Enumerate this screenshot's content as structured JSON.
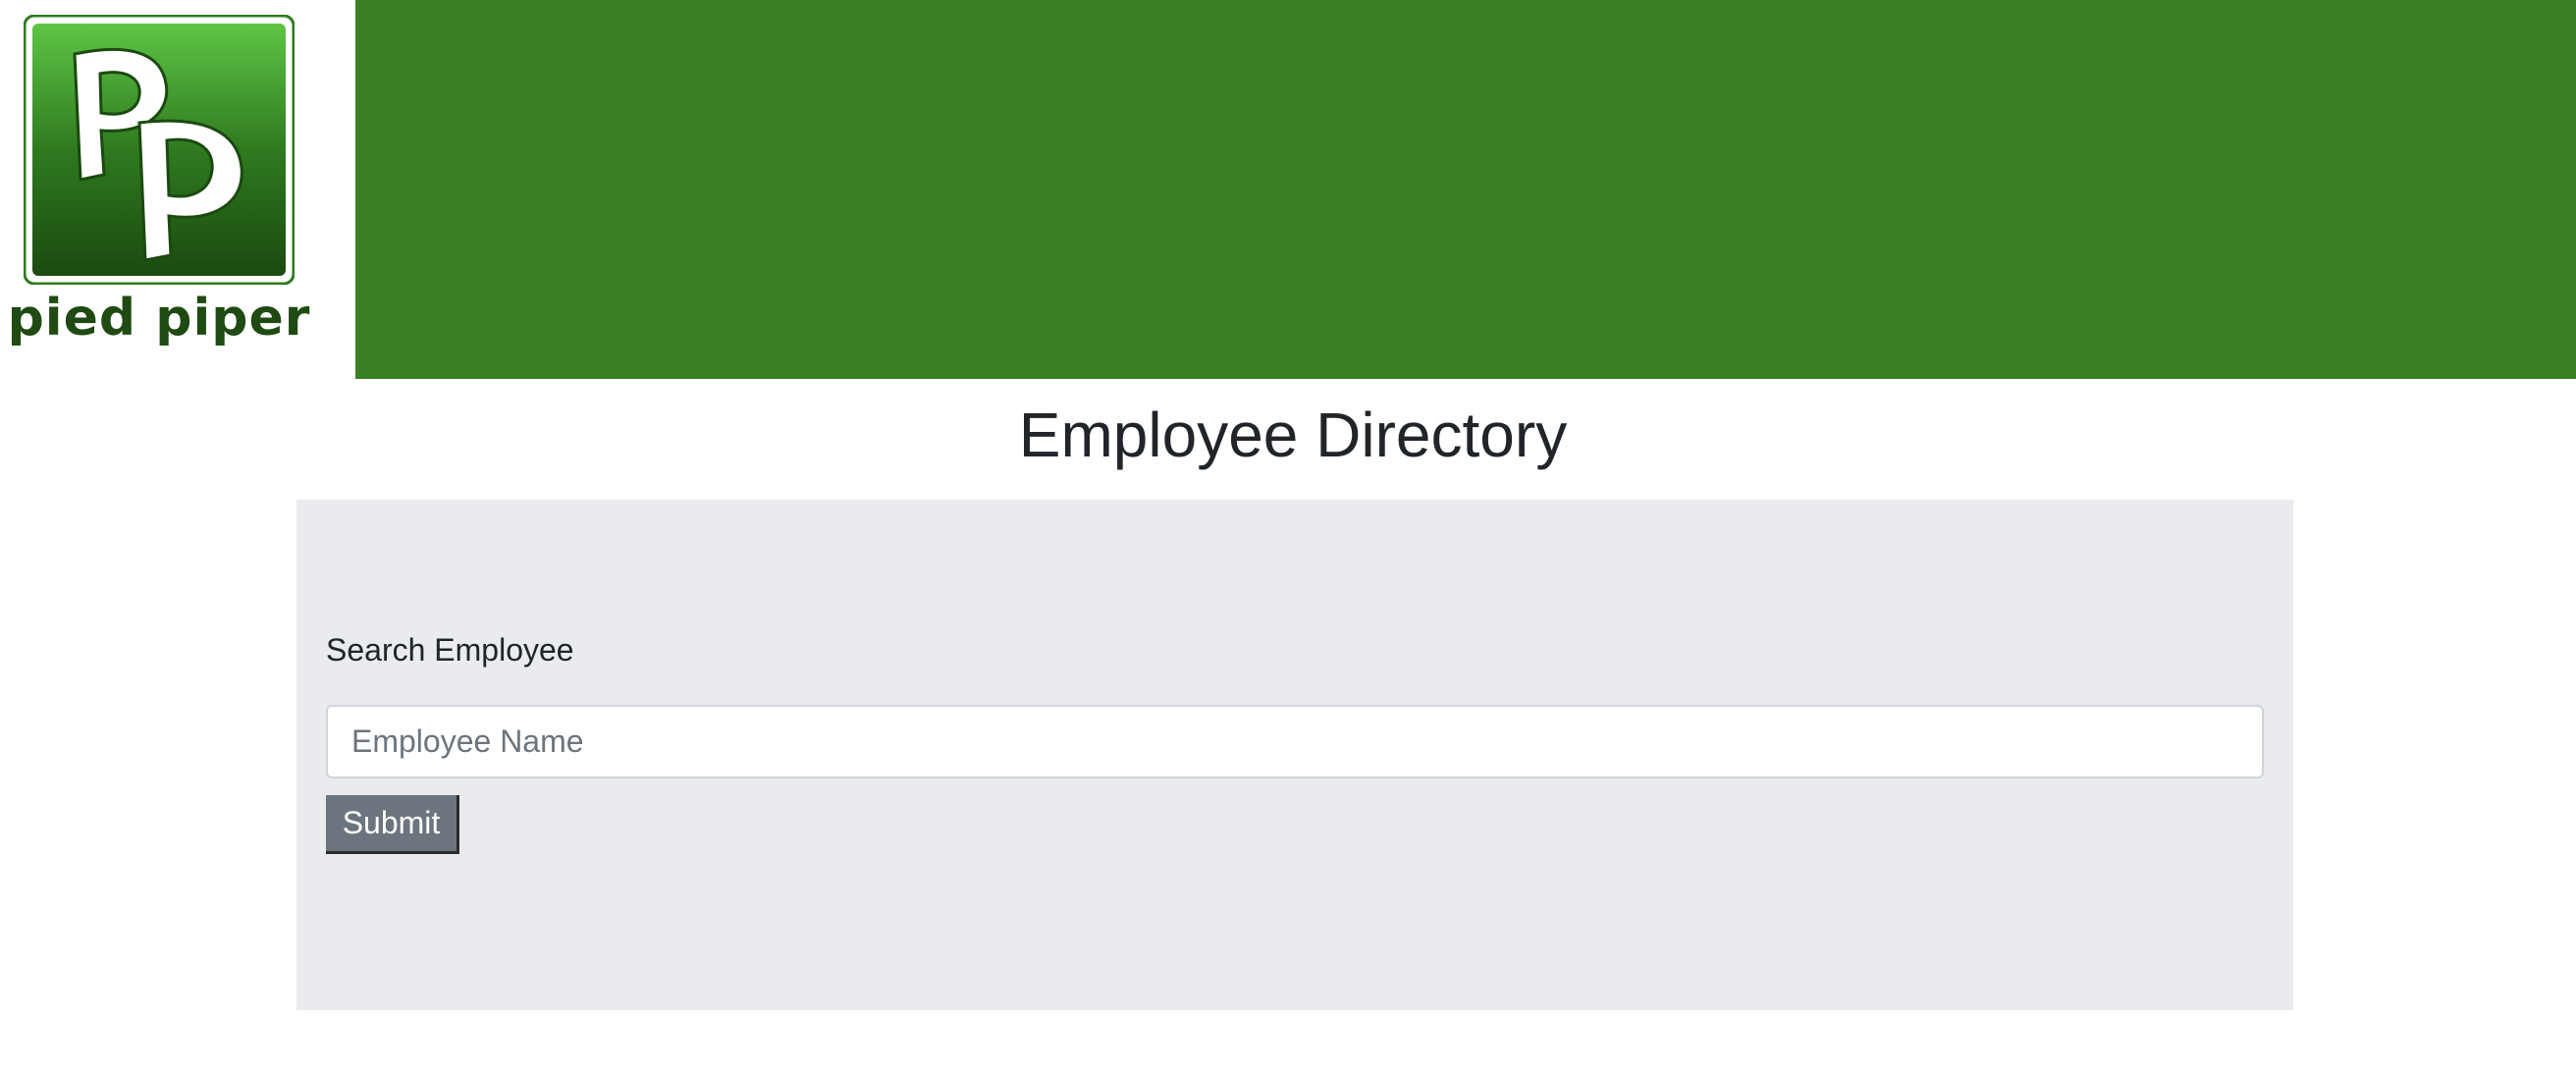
{
  "header": {
    "logo": {
      "monogram": "Pp",
      "wordmark": "pied piper"
    },
    "banner_color": "#388023"
  },
  "main": {
    "title": "Employee Directory",
    "search": {
      "label": "Search Employee",
      "placeholder": "Employee Name",
      "value": "",
      "submit_label": "Submit"
    }
  },
  "colors": {
    "brand_green": "#388023",
    "panel_background": "#e9ebef",
    "button_background": "#6c757d"
  }
}
